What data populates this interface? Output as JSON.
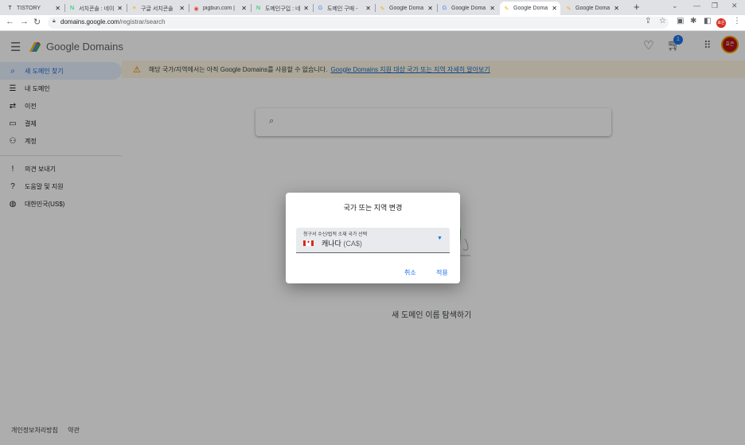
{
  "browser": {
    "tabs": [
      {
        "label": "TISTORY",
        "favicon": "T",
        "fav_color": "#202124"
      },
      {
        "label": "서치콘솔 : 네이",
        "favicon": "N",
        "fav_color": "#03c75a"
      },
      {
        "label": "구글 서치콘솔",
        "favicon": "≡",
        "fav_color": "#f9ab00"
      },
      {
        "label": "pigbun.com |",
        "favicon": "◉",
        "fav_color": "#ea4335"
      },
      {
        "label": "도메인구입 : 네",
        "favicon": "N",
        "fav_color": "#03c75a"
      },
      {
        "label": "도메인 구매 -",
        "favicon": "G",
        "fav_color": "#4285f4"
      },
      {
        "label": "Google Doma",
        "favicon": "✎",
        "fav_color": "#f9ab00"
      },
      {
        "label": "Google Doma",
        "favicon": "G",
        "fav_color": "#4285f4"
      },
      {
        "label": "Google Doma",
        "favicon": "✎",
        "fav_color": "#f9ab00",
        "active": true
      },
      {
        "label": "Google Doma",
        "favicon": "✎",
        "fav_color": "#f9ab00"
      }
    ],
    "url_host": "domains.google.com",
    "url_path": "/registrar/search",
    "profile_initials": "효은"
  },
  "app": {
    "brand": "Google Domains",
    "cart_count": "1",
    "avatar_initials": "효은",
    "banner": {
      "text": "해당 국가/지역에서는 아직 Google Domains를 사용할 수 없습니다.",
      "link": "Google Domains 지원 대상 국가 또는 지역 자세히 알아보기"
    },
    "nav": [
      {
        "label": "새 도메인 찾기",
        "icon": "search-icon",
        "glyph": "⌕",
        "selected": true
      },
      {
        "label": "내 도메인",
        "icon": "list-icon",
        "glyph": "☰"
      },
      {
        "label": "이전",
        "icon": "transfer-icon",
        "glyph": "⇄"
      },
      {
        "label": "결제",
        "icon": "credit-card-icon",
        "glyph": "▭"
      },
      {
        "label": "계정",
        "icon": "account-icon",
        "glyph": "⚇"
      },
      {
        "label": "의견 보내기",
        "icon": "feedback-icon",
        "glyph": "!"
      },
      {
        "label": "도움말 및 지원",
        "icon": "help-icon",
        "glyph": "?"
      },
      {
        "label": "대한민국(US$)",
        "icon": "globe-icon",
        "glyph": "◍"
      }
    ],
    "empty_caption": "새 도메인 이름 탐색하기",
    "footer": [
      "개인정보처리방침",
      "약관"
    ]
  },
  "dialog": {
    "title": "국가 또는 지역 변경",
    "select_label": "청구서 수신/법적 소재 국가 선택",
    "selected_country": "캐나다",
    "selected_currency": "(CA$)",
    "cancel_label": "취소",
    "apply_label": "적용"
  },
  "colors": {
    "accent": "#1a73e8",
    "banner_bg": "#fef7e0",
    "warning": "#e37400",
    "scrim": "rgba(0,0,0,0.32)"
  }
}
